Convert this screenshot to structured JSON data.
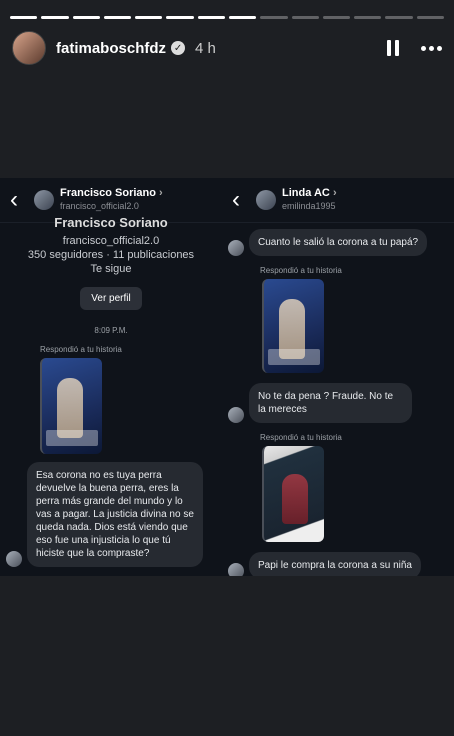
{
  "story": {
    "username": "fatimaboschfdz",
    "time": "4 h",
    "segments_total": 14,
    "segments_done": 8
  },
  "left_chat": {
    "name": "Francisco Soriano",
    "handle": "francisco_official2.0",
    "profile_name": "Francisco Soriano",
    "profile_handle": "francisco_official2.0",
    "stats": "350 seguidores · 11 publicaciones",
    "follows": "Te sigue",
    "view_profile": "Ver perfil",
    "timestamp": "8:09 P.M.",
    "replied": "Respondió a tu historia",
    "message": "Esa corona no es tuya perra devuelve la buena perra, eres la perra más grande del mundo y lo vas a pagar. La justicia divina no se queda nada. Dios está viendo que eso fue una injusticia lo que tú hiciste que la compraste?"
  },
  "right_chat": {
    "name": "Linda AC",
    "handle": "emilinda1995",
    "msg1": "Cuanto le salió la corona a tu papá?",
    "replied1": "Respondió a tu historia",
    "msg2": "No te da pena ? Fraude. No te la mereces",
    "replied2": "Respondió a tu historia",
    "msg3": "Papi le compra la corona a su niña"
  }
}
